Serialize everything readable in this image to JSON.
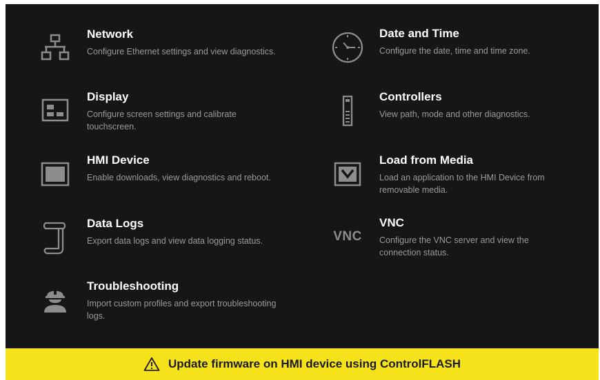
{
  "menu": {
    "network": {
      "title": "Network",
      "desc": "Configure Ethernet settings and view diagnostics.",
      "icon": "network-icon"
    },
    "display": {
      "title": "Display",
      "desc": "Configure screen settings and calibrate touchscreen.",
      "icon": "display-icon"
    },
    "hmi_device": {
      "title": "HMI Device",
      "desc": "Enable downloads, view diagnostics and reboot.",
      "icon": "monitor-icon"
    },
    "data_logs": {
      "title": "Data Logs",
      "desc": "Export data logs and view data logging status.",
      "icon": "scroll-icon"
    },
    "troubleshooting": {
      "title": "Troubleshooting",
      "desc": "Import custom profiles and export troubleshooting logs.",
      "icon": "hard-hat-worker-icon"
    },
    "date_time": {
      "title": "Date and Time",
      "desc": "Configure the date, time and time zone.",
      "icon": "clock-icon"
    },
    "controllers": {
      "title": "Controllers",
      "desc": "View path, mode and other diagnostics.",
      "icon": "controller-icon"
    },
    "load_media": {
      "title": "Load from Media",
      "desc": "Load an application to the HMI Device from removable media.",
      "icon": "download-monitor-icon"
    },
    "vnc": {
      "title": "VNC",
      "desc": "Configure the VNC server and view the connection status.",
      "icon_text": "VNC"
    }
  },
  "banner": {
    "text": "Update firmware on HMI device using ControlFLASH",
    "icon": "warning-icon",
    "color": "#f6e21a"
  },
  "colors": {
    "background": "#161616",
    "title": "#ffffff",
    "description": "#9a9a9a",
    "icon": "#8d8d8d"
  }
}
